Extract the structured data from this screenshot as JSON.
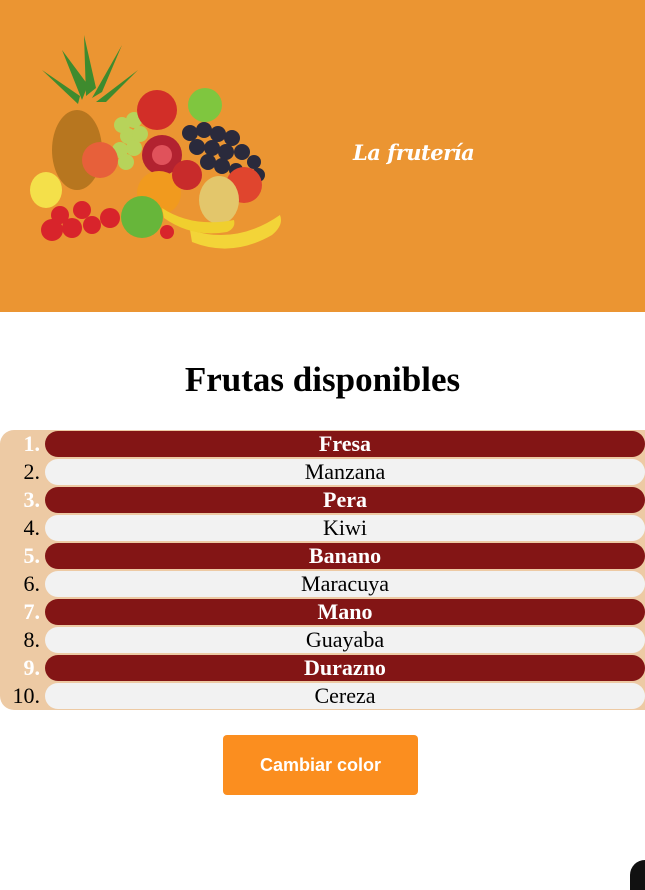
{
  "header": {
    "brand": "La frutería",
    "background": "#EB9532",
    "image_icon": "fruit-basket-illustration"
  },
  "main": {
    "title": "Frutas disponibles",
    "fruits": [
      {
        "number": "1.",
        "name": "Fresa"
      },
      {
        "number": "2.",
        "name": "Manzana"
      },
      {
        "number": "3.",
        "name": "Pera"
      },
      {
        "number": "4.",
        "name": "Kiwi"
      },
      {
        "number": "5.",
        "name": "Banano"
      },
      {
        "number": "6.",
        "name": "Maracuya"
      },
      {
        "number": "7.",
        "name": "Mano"
      },
      {
        "number": "8.",
        "name": "Guayaba"
      },
      {
        "number": "9.",
        "name": "Durazno"
      },
      {
        "number": "10.",
        "name": "Cereza"
      }
    ],
    "colors": {
      "odd_row": "#831515",
      "even_row": "#F2F2F2",
      "list_bg": "#EDCAA4"
    }
  },
  "actions": {
    "change_color_label": "Cambiar color",
    "button_color": "#FB8E1F"
  }
}
